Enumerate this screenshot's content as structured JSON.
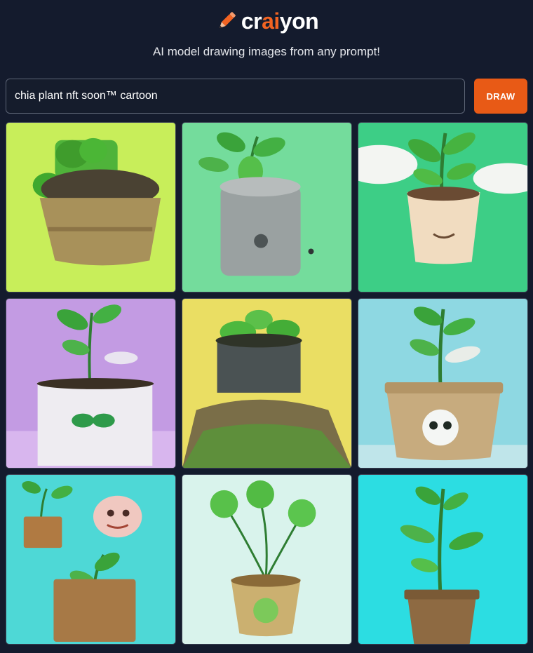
{
  "brand": {
    "name_part1": "cr",
    "name_part2": "ai",
    "name_part3": "yon",
    "icon": "pencil-icon",
    "accent_color": "#f26322"
  },
  "tagline": "AI model drawing images from any prompt!",
  "search": {
    "value": "chia plant nft soon™ cartoon",
    "placeholder": ""
  },
  "draw_button": {
    "label": "DRAW",
    "color": "#e85a16"
  },
  "results": {
    "count": 9,
    "images": [
      {
        "subject": "green plant in a brown pot with dark soil",
        "background": "#c8ee5a"
      },
      {
        "subject": "sprout in a grey cup with a face",
        "background": "#74dc9c"
      },
      {
        "subject": "sprout in a beige cup with clouds",
        "background": "#3dce86"
      },
      {
        "subject": "sprout above a white box with a face",
        "background": "#c39be3"
      },
      {
        "subject": "grassy pot on a yellow background",
        "background": "#eade63"
      },
      {
        "subject": "sprout in a tan pot with a skull face",
        "background": "#8ed8e2"
      },
      {
        "subject": "two potted sprouts and a cartoon face",
        "background": "#4ed8d6"
      },
      {
        "subject": "round-leaf plant in a tan pot",
        "background": "#d9f3ec"
      },
      {
        "subject": "tall sprout in a brown pot",
        "background": "#2cdde2"
      }
    ]
  }
}
